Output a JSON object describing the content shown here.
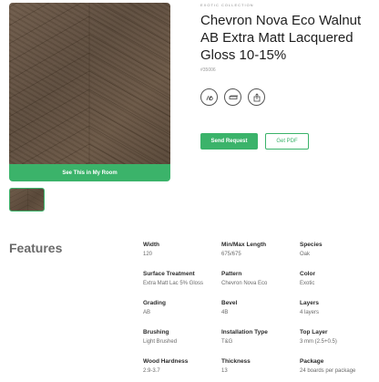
{
  "product": {
    "eyebrow": "EXOTIC COLLECTION",
    "title": "Chevron Nova Eco Walnut AB Extra Matt Lacquered Gloss 10-15%",
    "sku": "#35006",
    "see_room_label": "See This in My Room",
    "send_request_label": "Send Request",
    "get_pdf_label": "Get PDF",
    "icons": [
      "floor-heating-icon",
      "plank-icon",
      "share-icon"
    ]
  },
  "features": {
    "title": "Features",
    "specs": [
      {
        "label": "Width",
        "value": "120"
      },
      {
        "label": "Min/Max Length",
        "value": "675/675"
      },
      {
        "label": "Species",
        "value": "Oak"
      },
      {
        "label": "Surface Treatment",
        "value": "Extra Matt Lac 5% Gloss"
      },
      {
        "label": "Pattern",
        "value": "Chevron Nova Eco"
      },
      {
        "label": "Color",
        "value": "Exotic"
      },
      {
        "label": "Grading",
        "value": "AB"
      },
      {
        "label": "Bevel",
        "value": "4B"
      },
      {
        "label": "Layers",
        "value": "4 layers"
      },
      {
        "label": "Brushing",
        "value": "Light Brushed"
      },
      {
        "label": "Installation Type",
        "value": "T&G"
      },
      {
        "label": "Top Layer",
        "value": "3 mm (2.5+0.5)"
      },
      {
        "label": "Wood Hardness",
        "value": "2.9-3.7"
      },
      {
        "label": "Thickness",
        "value": "13"
      },
      {
        "label": "Package",
        "value": "24 boards per package"
      }
    ]
  },
  "colors": {
    "accent": "#3bb36a",
    "wood": "#655241"
  }
}
